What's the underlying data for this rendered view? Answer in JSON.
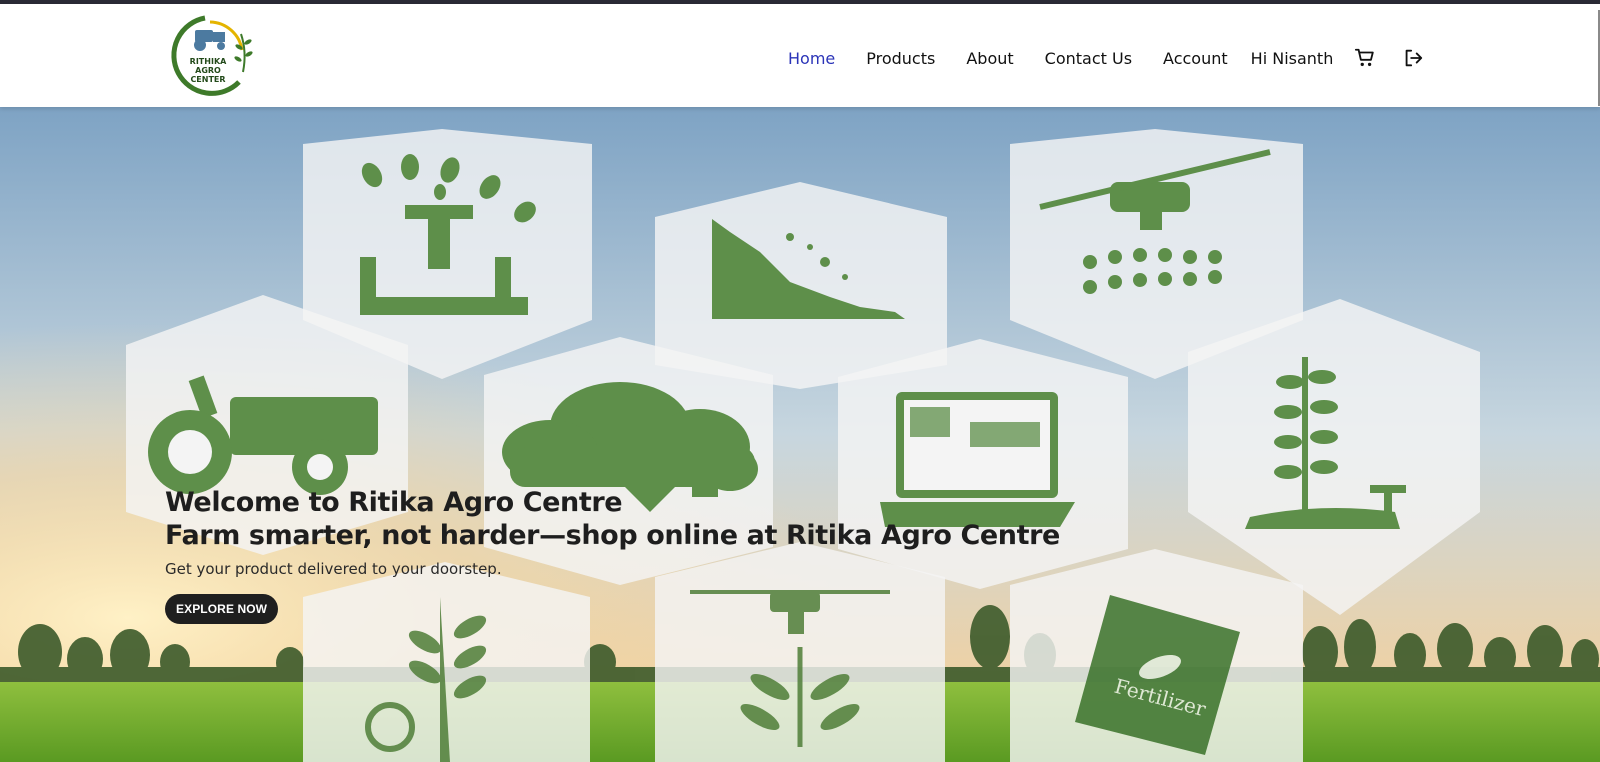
{
  "logo": {
    "text_line1": "RITHIKA",
    "text_line2": "AGRO",
    "text_line3": "CENTER"
  },
  "nav": {
    "items": [
      {
        "label": "Home",
        "active": true
      },
      {
        "label": "Products",
        "active": false
      },
      {
        "label": "About",
        "active": false
      },
      {
        "label": "Contact Us",
        "active": false
      },
      {
        "label": "Account",
        "active": false
      }
    ],
    "greeting": "Hi Nisanth",
    "cart_icon": "cart-icon",
    "logout_icon": "logout-icon"
  },
  "hero": {
    "title": "Welcome to Ritika Agro Centre",
    "subtitle": "Farm smarter, not harder—shop online at Ritika Agro Centre",
    "tagline": "Get your product delivered to your doorstep.",
    "cta_label": "EXPLORE NOW",
    "fertilizer_bag_label": "Fertilizer"
  },
  "colors": {
    "active_link": "#2b34b8",
    "icon_green": "#5e8f4a",
    "logo_green": "#3e7a2a",
    "button_bg": "#1f1f1f"
  }
}
